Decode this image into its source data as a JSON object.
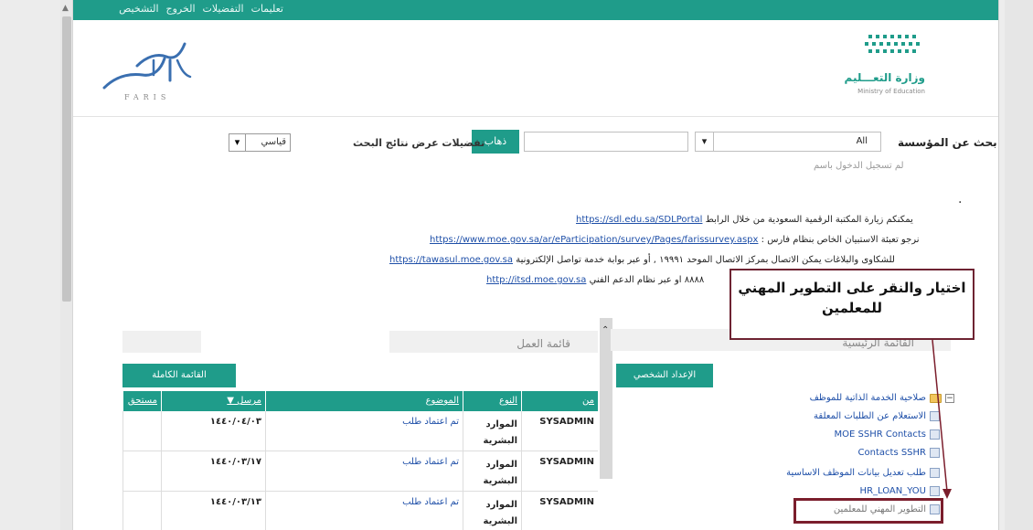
{
  "topbar": {
    "links": [
      "تعليمات",
      "التفضيلات",
      "الخروج",
      "التشخيص"
    ]
  },
  "header": {
    "faris_logo_word": "FARIS",
    "moe_name_ar": "وزارة التعـــليم",
    "moe_name_en": "Ministry of Education"
  },
  "search": {
    "institution_label": "بحث عن المؤسسة",
    "institution_value": "All",
    "go_button": "ذهاب",
    "prefs_label": "تفضيلات عرض نتائج البحث",
    "prefs_value": "قياسي",
    "not_logged": "لم تسجيل الدخول باسم"
  },
  "info": {
    "bullet": ".",
    "line1_text": "يمكنكم زيارة المكتبة الرقمية السعودية من خلال الرابط",
    "line1_link": "https://sdl.edu.sa/SDLPortal",
    "line2_text": "نرجو تعبئة الاستبيان الخاص بنظام فارس :",
    "line2_link": "https://www.moe.gov.sa/ar/eParticipation/survey/Pages/farissurvey.aspx",
    "line3_text": "للشكاوى والبلاغات يمكن الاتصال بمركز الاتصال الموحد ١٩٩٩١ , أو عبر بوابة خدمة تواصل الإلكترونية",
    "line3_link": "https://tawasul.moe.gov.sa",
    "line4_text": "٨٨٨٨ او عبر نظام الدعم الفني",
    "line4_link": "http://itsd.moe.gov.sa"
  },
  "callout": {
    "line1": "اختيار والنقر على التطوير المهني",
    "line2": "للمعلمين"
  },
  "main_menu": {
    "title": "القائمة الرئيسية",
    "profile_button": "الإعداد الشخصي",
    "root": "صلاحية الخدمة الذاتية للموظف",
    "items": [
      "الاستعلام عن الطلبات المعلقة",
      "MOE SSHR Contacts",
      "Contacts SSHR",
      "طلب تعديل بيانات الموظف الاساسية",
      "HR_LOAN_YOU",
      "التطوير المهني للمعلمين"
    ]
  },
  "worklist": {
    "title": "قائمة العمل",
    "full_list_button": "القائمة الكاملة",
    "columns": [
      "من",
      "النوع",
      "الموضوع",
      "مرسل ▼",
      "مستحق"
    ],
    "rows": [
      {
        "from": "SYSADMIN",
        "type": "الموارد البشرية",
        "subject": "تم اعتماد طلب",
        "sent": "١٤٤٠/٠٤/٠٣",
        "due": ""
      },
      {
        "from": "SYSADMIN",
        "type": "الموارد البشرية",
        "subject": "تم اعتماد طلب",
        "sent": "١٤٤٠/٠٣/١٧",
        "due": ""
      },
      {
        "from": "SYSADMIN",
        "type": "الموارد البشرية",
        "subject": "تم اعتماد طلب",
        "sent": "١٤٤٠/٠٣/١٣",
        "due": ""
      }
    ]
  },
  "colors": {
    "brand": "#1f9c8a",
    "link": "#1e4fa8",
    "callout_border": "#6e2332"
  }
}
